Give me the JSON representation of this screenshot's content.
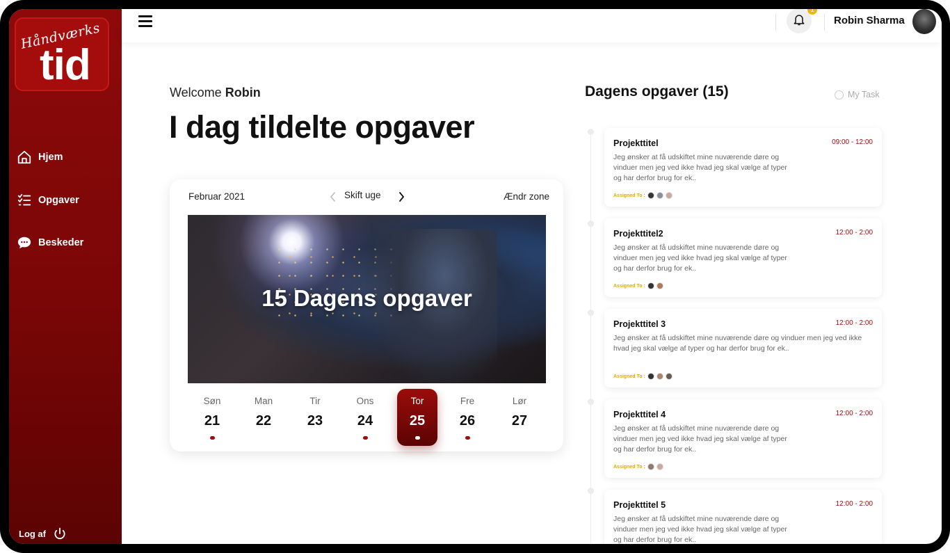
{
  "sidebar": {
    "logo_script": "Håndværks",
    "logo_main": "tid",
    "items": [
      {
        "label": "Hjem",
        "icon": "home-icon"
      },
      {
        "label": "Opgaver",
        "icon": "checklist-icon"
      },
      {
        "label": "Beskeder",
        "icon": "chat-icon"
      }
    ],
    "logout_label": "Log af"
  },
  "header": {
    "notification_count": "1",
    "user_name": "Robin Sharma"
  },
  "main": {
    "welcome_prefix": "Welcome",
    "welcome_name": "Robin",
    "title": "I dag tildelte opgaver",
    "calendar": {
      "month": "Februar 2021",
      "week_label": "Skift uge",
      "zone_label": "Ændr zone",
      "banner_text": "15 Dagens opgaver",
      "days": [
        {
          "name": "Søn",
          "date": "21",
          "has_tasks": true
        },
        {
          "name": "Man",
          "date": "22",
          "has_tasks": false
        },
        {
          "name": "Tir",
          "date": "23",
          "has_tasks": false
        },
        {
          "name": "Ons",
          "date": "24",
          "has_tasks": true
        },
        {
          "name": "Tor",
          "date": "25",
          "has_tasks": true,
          "selected": true
        },
        {
          "name": "Fre",
          "date": "26",
          "has_tasks": true
        },
        {
          "name": "Lør",
          "date": "27",
          "has_tasks": false
        }
      ]
    }
  },
  "tasks": {
    "title": "Dagens opgaver (15)",
    "my_task_label": "My Task",
    "assigned_label": "Assigned To :",
    "items": [
      {
        "title": "Projekttitel",
        "time": "09:00 - 12:00",
        "desc": "Jeg ønsker at få udskiftet mine nuværende døre og vinduer men jeg ved ikke hvad jeg skal vælge af typer og har  derfor brug for ek..",
        "assignees": 3
      },
      {
        "title": "Projekttitel2",
        "time": "12:00 - 2:00",
        "desc": "Jeg ønsker at få udskiftet mine nuværende døre og vinduer men jeg ved ikke hvad jeg skal vælge af typer og har  derfor brug for ek..",
        "assignees": 2
      },
      {
        "title": "Projekttitel 3",
        "time": "12:00 - 2:00",
        "desc": "Jeg ønsker at få udskiftet mine nuværende døre og vinduer men jeg ved ikke hvad jeg skal vælge af typer og har  derfor brug for ek..",
        "assignees": 3
      },
      {
        "title": "Projekttitel 4",
        "time": "12:00 - 2:00",
        "desc": "Jeg ønsker at få udskiftet mine nuværende døre og vinduer men jeg ved ikke hvad jeg skal vælge af typer og har  derfor brug for ek..",
        "assignees": 2
      },
      {
        "title": "Projekttitel 5",
        "time": "12:00 - 2:00",
        "desc": "Jeg ønsker at få udskiftet mine nuværende døre og vinduer men jeg ved ikke hvad jeg skal vælge af typer og har  derfor brug for ek..",
        "assignees": 0
      }
    ]
  },
  "colors": {
    "brand": "#8e0a0a",
    "accent_dark": "#5c0303",
    "badge": "#f4b400",
    "assigned": "#e6a700"
  }
}
